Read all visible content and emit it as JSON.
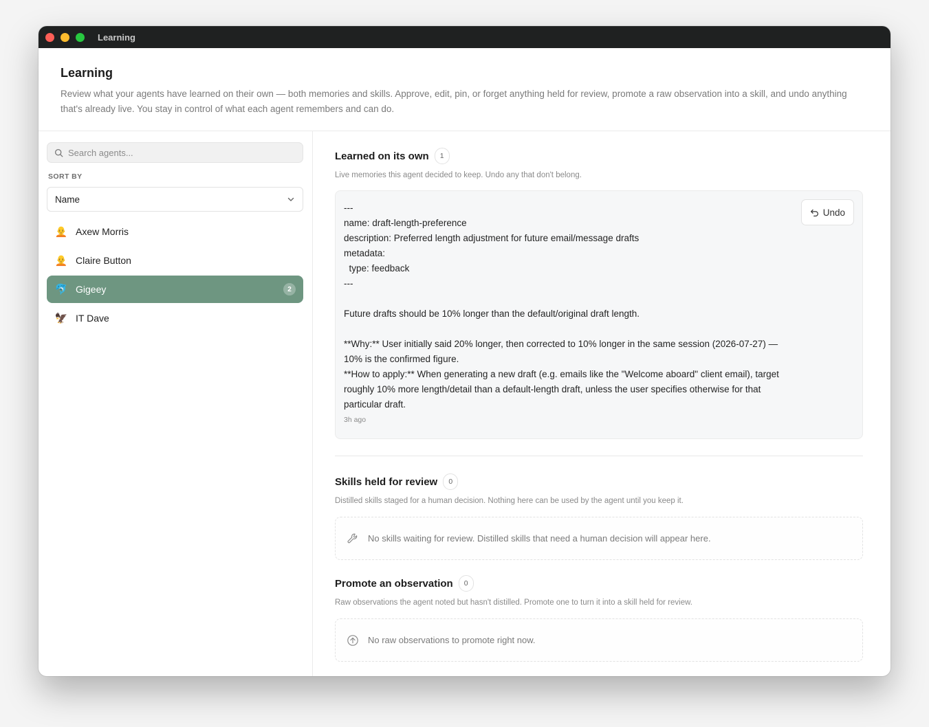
{
  "window": {
    "title": "Learning"
  },
  "header": {
    "title": "Learning",
    "description": "Review what your agents have learned on their own — both memories and skills. Approve, edit, pin, or forget anything held for review, promote a raw observation into a skill, and undo anything that's already live. You stay in control of what each agent remembers and can do."
  },
  "sidebar": {
    "search_placeholder": "Search agents...",
    "sort_label": "SORT BY",
    "sort_value": "Name",
    "agents": [
      {
        "name": "Axew Morris",
        "emoji": "🧑‍🦲",
        "selected": false
      },
      {
        "name": "Claire Button",
        "emoji": "🧑‍🦲",
        "selected": false
      },
      {
        "name": "Gigeey",
        "emoji": "🐬",
        "selected": true,
        "badge": "2"
      },
      {
        "name": "IT Dave",
        "emoji": "🦅",
        "selected": false
      }
    ]
  },
  "learned": {
    "title": "Learned on its own",
    "count": "1",
    "subtitle": "Live memories this agent decided to keep. Undo any that don't belong.",
    "memory_text": "---\nname: draft-length-preference\ndescription: Preferred length adjustment for future email/message drafts\nmetadata:\n  type: feedback\n---\n\nFuture drafts should be 10% longer than the default/original draft length.\n\n**Why:** User initially said 20% longer, then corrected to 10% longer in the same session (2026-07-27) — 10% is the confirmed figure.\n**How to apply:** When generating a new draft (e.g. emails like the \"Welcome aboard\" client email), target roughly 10% more length/detail than a default-length draft, unless the user specifies otherwise for that particular draft.",
    "memory_time": "3h ago",
    "undo_label": "Undo"
  },
  "skills": {
    "title": "Skills held for review",
    "count": "0",
    "subtitle": "Distilled skills staged for a human decision. Nothing here can be used by the agent until you keep it.",
    "empty_text": "No skills waiting for review. Distilled skills that need a human decision will appear here.",
    "icon": "wrench-icon"
  },
  "promote": {
    "title": "Promote an observation",
    "count": "0",
    "subtitle": "Raw observations the agent noted but hasn't distilled. Promote one to turn it into a skill held for review.",
    "empty_text": "No raw observations to promote right now.",
    "icon": "arrow-up-circle-icon"
  },
  "colors": {
    "selected_agent_bg": "#6e9681",
    "titlebar_bg": "#1f2121"
  }
}
